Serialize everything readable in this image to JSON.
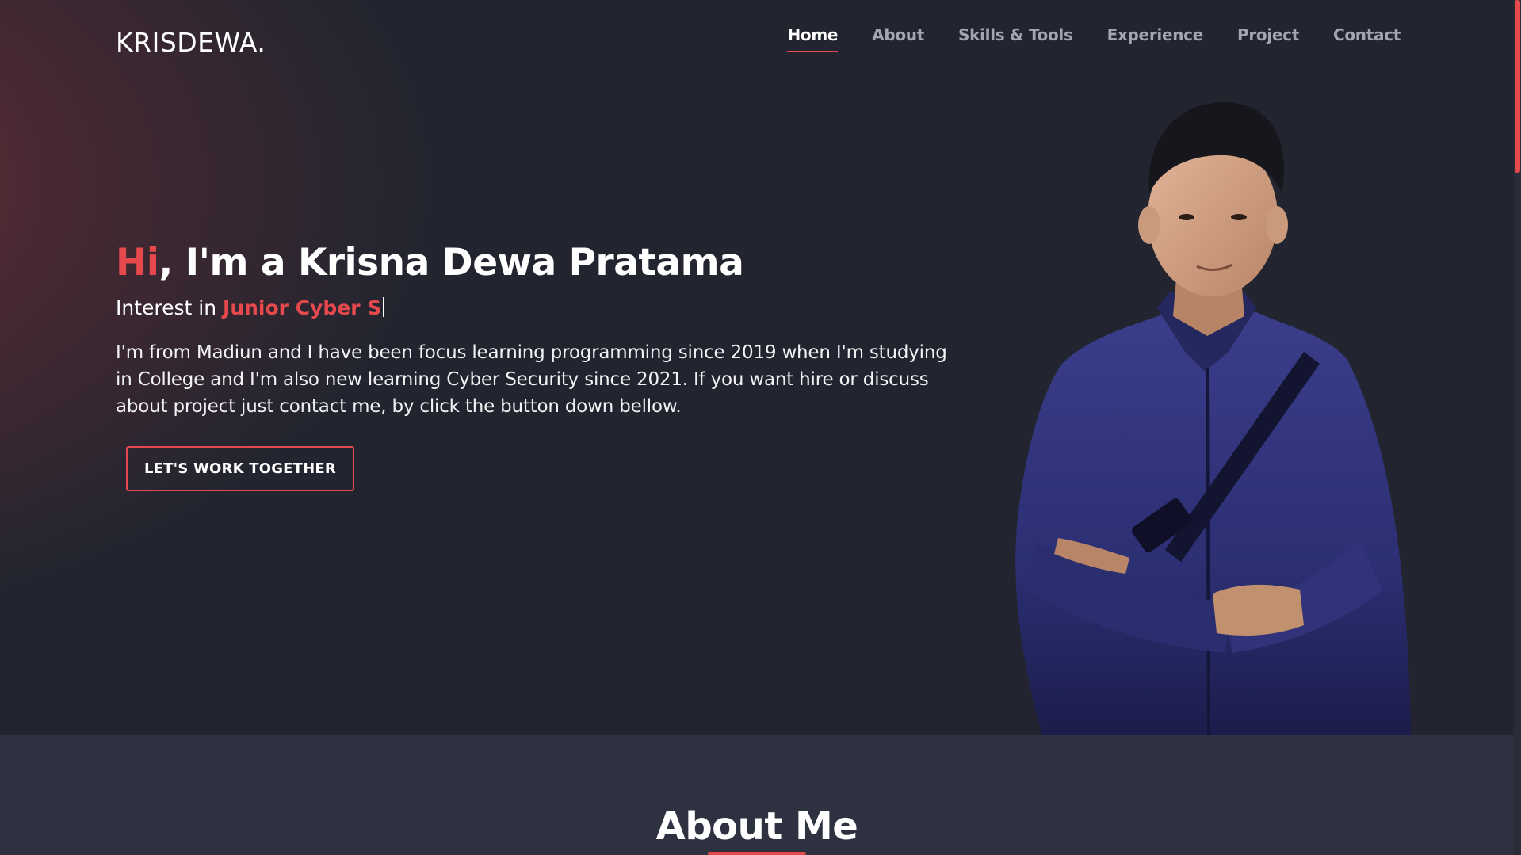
{
  "brand": {
    "logo": "KRISDEWA."
  },
  "nav": {
    "items": [
      {
        "label": "Home",
        "active": true
      },
      {
        "label": "About"
      },
      {
        "label": "Skills & Tools"
      },
      {
        "label": "Experience"
      },
      {
        "label": "Project"
      },
      {
        "label": "Contact"
      }
    ]
  },
  "hero": {
    "greeting": "Hi",
    "headline_rest": ", I'm a Krisna Dewa Pratama",
    "interest_prefix": "Interest in ",
    "interest_role": "Junior Cyber S",
    "bio": "I'm from Madiun and I have been focus learning programming since 2019 when I'm studying in College and I'm also new learning Cyber Security since 2021. If you want hire or discuss about project just contact me, by click the button down bellow.",
    "cta_label": "LET'S WORK TOGETHER"
  },
  "about": {
    "title": "About Me"
  },
  "colors": {
    "accent": "#e5484d",
    "hero_background": "#22252f",
    "about_background": "#2e3240",
    "nav_inactive": "#a3a6b1"
  },
  "scroll": {
    "position_fraction": 0
  }
}
